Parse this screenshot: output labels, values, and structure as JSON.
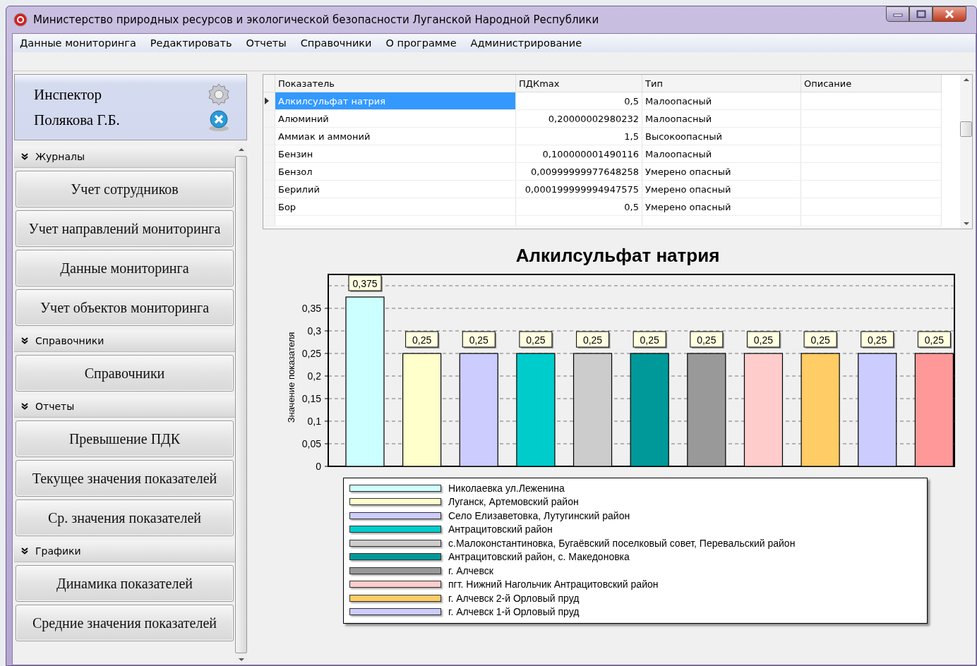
{
  "window": {
    "title": "Министерство природных ресурсов и экологической безопасности Луганской Народной Республики"
  },
  "menu": [
    "Данные мониторинга",
    "Редактировать",
    "Отчеты",
    "Справочники",
    "О программе",
    "Администрирование"
  ],
  "user": {
    "role": "Инспектор",
    "name": "Полякова Г.Б."
  },
  "sidebar": [
    {
      "title": "Журналы",
      "items": [
        "Учет сотрудников",
        "Учет направлений мониторинга",
        "Данные мониторинга",
        "Учет объектов мониторинга"
      ]
    },
    {
      "title": "Справочники",
      "items": [
        "Справочники"
      ]
    },
    {
      "title": "Отчеты",
      "items": [
        "Превышение ПДК",
        "Текущее значения показателей",
        "Ср. значения показателей"
      ]
    },
    {
      "title": "Графики",
      "items": [
        "Динамика показателей",
        "Средние значения показателей"
      ]
    }
  ],
  "table": {
    "columns": [
      "Показатель",
      "ПДКmax",
      "Тип",
      "Описание"
    ],
    "rows": [
      {
        "name": "Алкилсульфат натрия",
        "pdk": "0,5",
        "type": "Малоопасный",
        "selected": true
      },
      {
        "name": "Алюминий",
        "pdk": "0,20000002980232",
        "type": "Малоопасный",
        "selected": false
      },
      {
        "name": "Аммиак и аммоний",
        "pdk": "1,5",
        "type": "Высокоопасный",
        "selected": false
      },
      {
        "name": "Бензин",
        "pdk": "0,100000001490116",
        "type": "Малоопасный",
        "selected": false
      },
      {
        "name": "Бензол",
        "pdk": "0,00999999977648258",
        "type": "Умерено опасный",
        "selected": false
      },
      {
        "name": "Берилий",
        "pdk": "0,000199999994947575",
        "type": "Умерено опасный",
        "selected": false
      },
      {
        "name": "Бор",
        "pdk": "0,5",
        "type": "Умерено опасный",
        "selected": false
      }
    ]
  },
  "chart_data": {
    "type": "bar",
    "title": "Алкилсульфат натрия",
    "ylabel": "Значение показателя",
    "ylim": [
      0,
      0.425
    ],
    "grid": true,
    "yticks": [
      {
        "value": 0,
        "label": "0"
      },
      {
        "value": 0.05,
        "label": "0,05"
      },
      {
        "value": 0.1,
        "label": "0,1"
      },
      {
        "value": 0.15,
        "label": "0,15"
      },
      {
        "value": 0.2,
        "label": "0,2"
      },
      {
        "value": 0.25,
        "label": "0,25"
      },
      {
        "value": 0.3,
        "label": "0,3"
      },
      {
        "value": 0.35,
        "label": "0,35"
      }
    ],
    "series": [
      {
        "name": "Николаевка ул.Леженина",
        "color": "#ccffff",
        "values": [
          0.375
        ],
        "value_labels": [
          "0,375"
        ]
      },
      {
        "name": "Луганск, Артемовский район",
        "color": "#ffffcc",
        "values": [
          0.25
        ],
        "value_labels": [
          "0,25"
        ]
      },
      {
        "name": "Село Елизаветовка, Лутугинский район",
        "color": "#ccccff",
        "values": [
          0.25
        ],
        "value_labels": [
          "0,25"
        ]
      },
      {
        "name": "Антрацитовский район",
        "color": "#00cccc",
        "values": [
          0.25
        ],
        "value_labels": [
          "0,25"
        ]
      },
      {
        "name": "с.Малоконстантиновка, Бугаёвский поселковый совет, Перевальский район",
        "color": "#cccccc",
        "values": [
          0.25
        ],
        "value_labels": [
          "0,25"
        ]
      },
      {
        "name": "Антрацитовский район, с. Македоновка",
        "color": "#009999",
        "values": [
          0.25
        ],
        "value_labels": [
          "0,25"
        ]
      },
      {
        "name": "г. Алчевск",
        "color": "#999999",
        "values": [
          0.25
        ],
        "value_labels": [
          "0,25"
        ]
      },
      {
        "name": "пгт. Нижний Нагольчик Антрацитовский район",
        "color": "#ffcccc",
        "values": [
          0.25
        ],
        "value_labels": [
          "0,25"
        ]
      },
      {
        "name": "г. Алчевск 2-й Орловый пруд",
        "color": "#ffcc66",
        "values": [
          0.25
        ],
        "value_labels": [
          "0,25"
        ]
      },
      {
        "name": "г. Алчевск 1-й Орловый пруд",
        "color": "#ccccff",
        "values": [
          0.25
        ],
        "value_labels": [
          "0,25"
        ]
      },
      {
        "color": "#ff9999",
        "values": [
          0.25
        ],
        "value_labels": [
          "0,25"
        ]
      }
    ]
  }
}
